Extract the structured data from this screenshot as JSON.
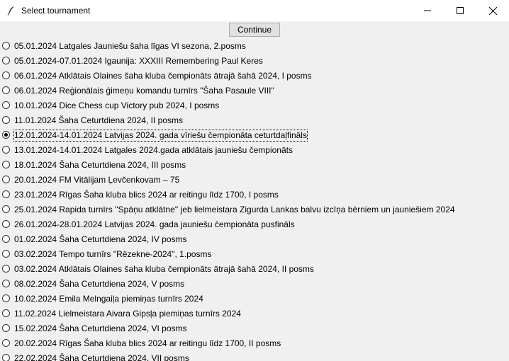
{
  "window": {
    "title": "Select tournament"
  },
  "toolbar": {
    "continue_label": "Continue"
  },
  "tournaments": [
    {
      "label": "05.01.2024 Latgales Jauniešu šaha līgas VI sezona, 2.posms",
      "selected": false
    },
    {
      "label": "05.01.2024-07.01.2024 Igaunija: XXXIII Remembering Paul Keres",
      "selected": false
    },
    {
      "label": "06.01.2024 Atklātais Olaines šaha kluba čempionāts ātrajā šahā 2024, I posms",
      "selected": false
    },
    {
      "label": "06.01.2024 Reģionālais ģimeņu komandu turnīrs \"Šaha Pasaule VIII\"",
      "selected": false
    },
    {
      "label": "10.01.2024 Dice Chess cup Victory pub 2024, I posms",
      "selected": false
    },
    {
      "label": "11.01.2024 Šaha Ceturtdiena 2024, II posms",
      "selected": false
    },
    {
      "label": "12.01.2024-14.01.2024 Latvijas 2024. gada vīriešu čempionāta ceturtdaļfināls",
      "selected": true
    },
    {
      "label": "13.01.2024-14.01.2024 Latgales 2024.gada atklātais jauniešu čempionāts",
      "selected": false
    },
    {
      "label": "18.01.2024 Šaha Ceturtdiena 2024, III posms",
      "selected": false
    },
    {
      "label": "20.01.2024 FM Vitālijam Ļevčenkovam – 75",
      "selected": false
    },
    {
      "label": "23.01.2024 Rīgas Šaha kluba blics 2024 ar reitingu līdz 1700, I posms",
      "selected": false
    },
    {
      "label": "25.01.2024 Rapida turnīrs ''Spāņu atklātne'' jeb lielmeistara Zigurda Lankas balvu izcīņa bērniem un jauniešiem 2024",
      "selected": false
    },
    {
      "label": "26.01.2024-28.01.2024 Latvijas 2024. gada jauniešu čempionāta pusfināls",
      "selected": false
    },
    {
      "label": "01.02.2024 Šaha Ceturtdiena 2024, IV posms",
      "selected": false
    },
    {
      "label": "03.02.2024 Tempo turnīrs \"Rēzekne-2024\", 1.posms",
      "selected": false
    },
    {
      "label": "03.02.2024 Atklātais Olaines šaha kluba čempionāts ātrajā šahā 2024, II posms",
      "selected": false
    },
    {
      "label": "08.02.2024 Šaha Ceturtdiena 2024, V posms",
      "selected": false
    },
    {
      "label": "10.02.2024 Emila Melngaiļa piemiņas turnīrs 2024",
      "selected": false
    },
    {
      "label": "11.02.2024 Lielmeistara Aivara Gipsļa piemiņas turnīrs 2024",
      "selected": false
    },
    {
      "label": "15.02.2024 Šaha Ceturtdiena 2024, VI posms",
      "selected": false
    },
    {
      "label": "20.02.2024 Rīgas Šaha kluba blics 2024 ar reitingu līdz 1700, II posms",
      "selected": false
    },
    {
      "label": "22.02.2024 Šaha Ceturtdiena 2024, VII posms",
      "selected": false
    }
  ]
}
